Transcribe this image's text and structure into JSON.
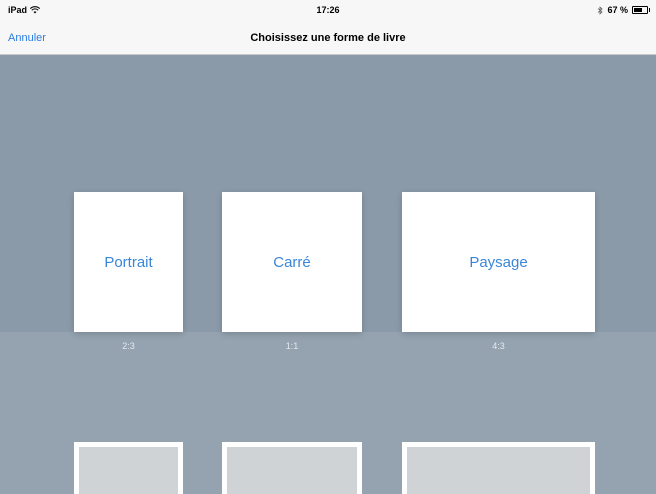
{
  "status_bar": {
    "device": "iPad",
    "wifi_icon": "wifi-icon",
    "time": "17:26",
    "bluetooth_icon": "bluetooth-icon",
    "battery_percent": "67 %",
    "battery_level": 0.67
  },
  "nav": {
    "cancel_label": "Annuler",
    "title": "Choisissez une forme de livre"
  },
  "shapes": [
    {
      "label": "Portrait",
      "ratio": "2:3"
    },
    {
      "label": "Carré",
      "ratio": "1:1"
    },
    {
      "label": "Paysage",
      "ratio": "4:3"
    }
  ],
  "colors": {
    "accent": "#3a86d8",
    "background_top": "#8b9aa9",
    "background_bottom": "#95a3b1"
  }
}
